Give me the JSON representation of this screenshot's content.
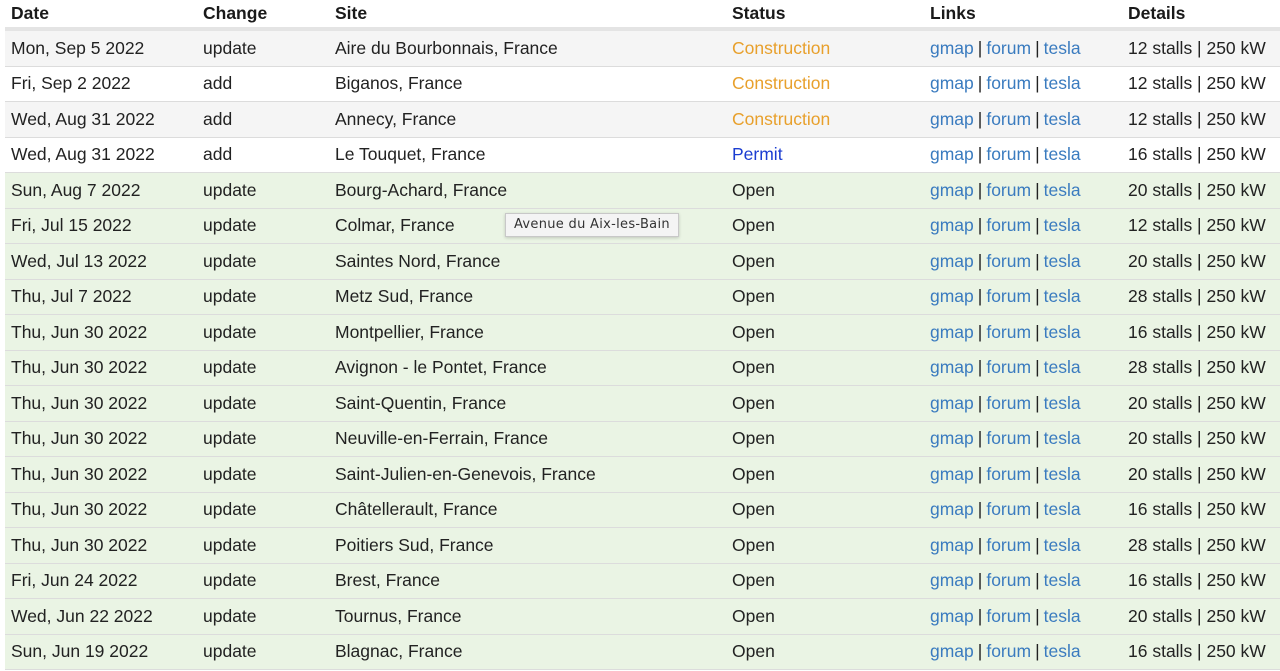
{
  "columns": {
    "date": "Date",
    "change": "Change",
    "site": "Site",
    "status": "Status",
    "links": "Links",
    "details": "Details"
  },
  "colors": {
    "construction": "#e8a02c",
    "permit": "#1b3dd1",
    "open_row_bg": "#eaf4e4",
    "link": "#3a7bbf"
  },
  "rows": [
    {
      "date": "Mon, Sep 5 2022",
      "change": "update",
      "site": "Aire du Bourbonnais, France",
      "status": "Construction",
      "links": [
        "gmap",
        "forum",
        "tesla"
      ],
      "details": "12 stalls | 250 kW"
    },
    {
      "date": "Fri, Sep 2 2022",
      "change": "add",
      "site": "Biganos, France",
      "status": "Construction",
      "links": [
        "gmap",
        "forum",
        "tesla"
      ],
      "details": "12 stalls | 250 kW"
    },
    {
      "date": "Wed, Aug 31 2022",
      "change": "add",
      "site": "Annecy, France",
      "status": "Construction",
      "links": [
        "gmap",
        "forum",
        "tesla"
      ],
      "details": "12 stalls | 250 kW"
    },
    {
      "date": "Wed, Aug 31 2022",
      "change": "add",
      "site": "Le Touquet, France",
      "status": "Permit",
      "links": [
        "gmap",
        "forum",
        "tesla"
      ],
      "details": "16 stalls | 250 kW"
    },
    {
      "date": "Sun, Aug 7 2022",
      "change": "update",
      "site": "Bourg-Achard, France",
      "status": "Open",
      "links": [
        "gmap",
        "forum",
        "tesla"
      ],
      "details": "20 stalls | 250 kW"
    },
    {
      "date": "Fri, Jul 15 2022",
      "change": "update",
      "site": "Colmar, France",
      "status": "Open",
      "links": [
        "gmap",
        "forum",
        "tesla"
      ],
      "details": "12 stalls | 250 kW"
    },
    {
      "date": "Wed, Jul 13 2022",
      "change": "update",
      "site": "Saintes Nord, France",
      "status": "Open",
      "links": [
        "gmap",
        "forum",
        "tesla"
      ],
      "details": "20 stalls | 250 kW"
    },
    {
      "date": "Thu, Jul 7 2022",
      "change": "update",
      "site": "Metz Sud, France",
      "status": "Open",
      "links": [
        "gmap",
        "forum",
        "tesla"
      ],
      "details": "28 stalls | 250 kW"
    },
    {
      "date": "Thu, Jun 30 2022",
      "change": "update",
      "site": "Montpellier, France",
      "status": "Open",
      "links": [
        "gmap",
        "forum",
        "tesla"
      ],
      "details": "16 stalls | 250 kW"
    },
    {
      "date": "Thu, Jun 30 2022",
      "change": "update",
      "site": "Avignon - le Pontet, France",
      "status": "Open",
      "links": [
        "gmap",
        "forum",
        "tesla"
      ],
      "details": "28 stalls | 250 kW"
    },
    {
      "date": "Thu, Jun 30 2022",
      "change": "update",
      "site": "Saint-Quentin, France",
      "status": "Open",
      "links": [
        "gmap",
        "forum",
        "tesla"
      ],
      "details": "20 stalls | 250 kW"
    },
    {
      "date": "Thu, Jun 30 2022",
      "change": "update",
      "site": "Neuville-en-Ferrain, France",
      "status": "Open",
      "links": [
        "gmap",
        "forum",
        "tesla"
      ],
      "details": "20 stalls | 250 kW"
    },
    {
      "date": "Thu, Jun 30 2022",
      "change": "update",
      "site": "Saint-Julien-en-Genevois, France",
      "status": "Open",
      "links": [
        "gmap",
        "forum",
        "tesla"
      ],
      "details": "20 stalls | 250 kW"
    },
    {
      "date": "Thu, Jun 30 2022",
      "change": "update",
      "site": "Châtellerault, France",
      "status": "Open",
      "links": [
        "gmap",
        "forum",
        "tesla"
      ],
      "details": "16 stalls | 250 kW"
    },
    {
      "date": "Thu, Jun 30 2022",
      "change": "update",
      "site": "Poitiers Sud, France",
      "status": "Open",
      "links": [
        "gmap",
        "forum",
        "tesla"
      ],
      "details": "28 stalls | 250 kW"
    },
    {
      "date": "Fri, Jun 24 2022",
      "change": "update",
      "site": "Brest, France",
      "status": "Open",
      "links": [
        "gmap",
        "forum",
        "tesla"
      ],
      "details": "16 stalls | 250 kW"
    },
    {
      "date": "Wed, Jun 22 2022",
      "change": "update",
      "site": "Tournus, France",
      "status": "Open",
      "links": [
        "gmap",
        "forum",
        "tesla"
      ],
      "details": "20 stalls | 250 kW"
    },
    {
      "date": "Sun, Jun 19 2022",
      "change": "update",
      "site": "Blagnac, France",
      "status": "Open",
      "links": [
        "gmap",
        "forum",
        "tesla"
      ],
      "details": "16 stalls | 250 kW"
    }
  ],
  "tooltip": {
    "text": "Avenue du Aix-les-Bain"
  }
}
